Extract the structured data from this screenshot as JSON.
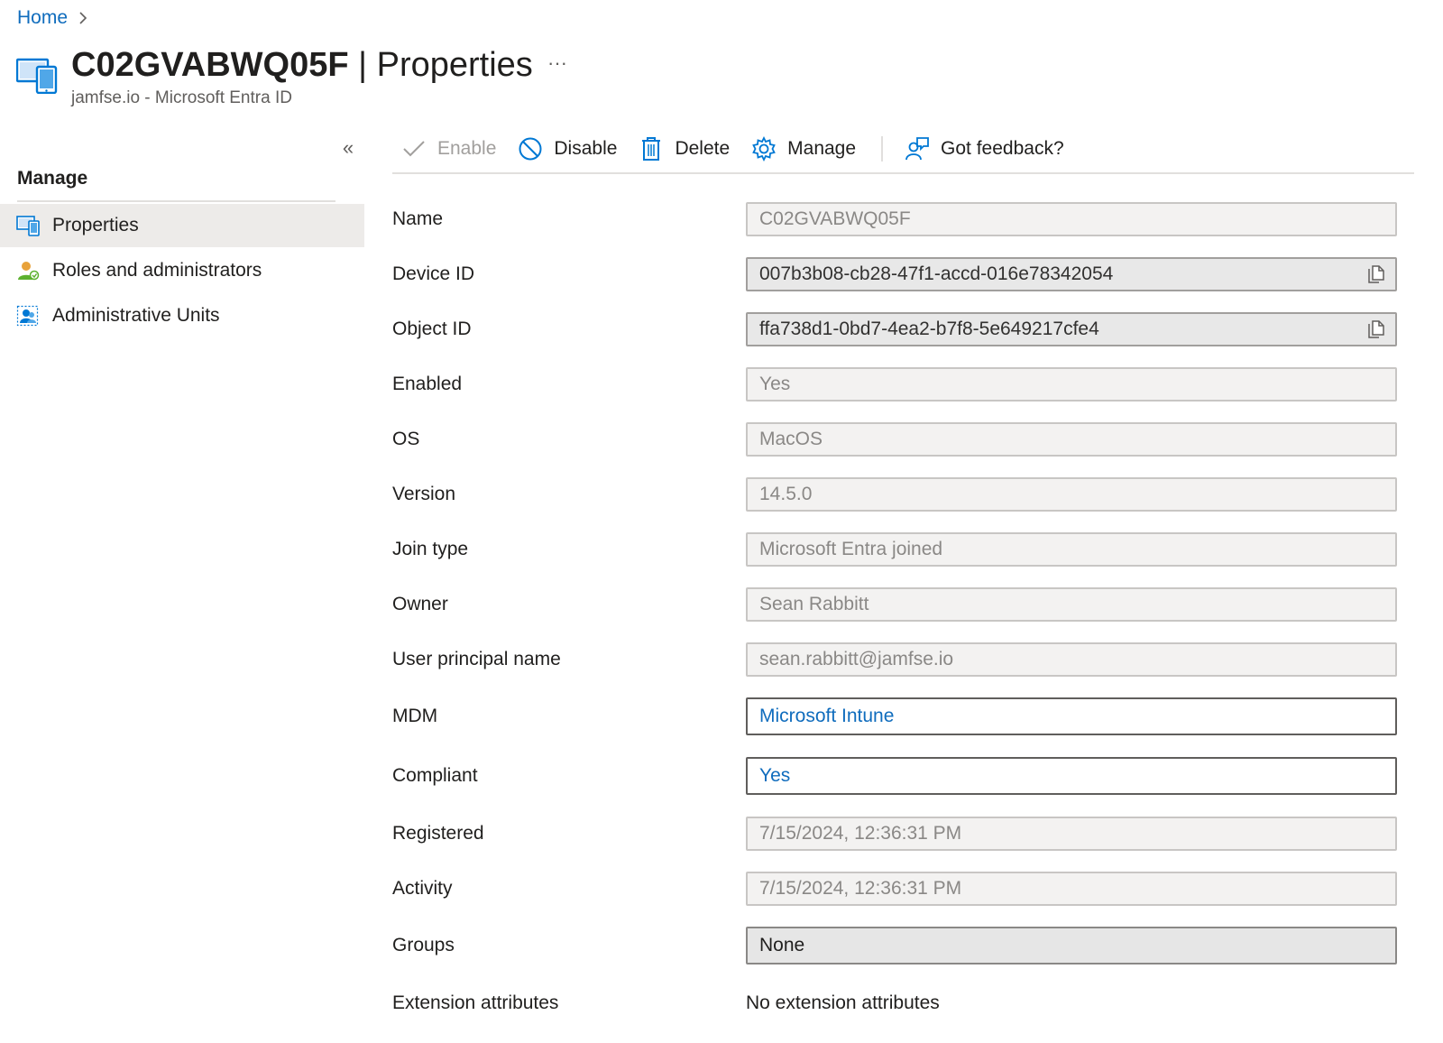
{
  "breadcrumb": {
    "home": "Home"
  },
  "header": {
    "device_name": "C02GVABWQ05F",
    "separator": " | ",
    "page_name": "Properties",
    "more": "···",
    "subtitle": "jamfse.io - Microsoft Entra ID"
  },
  "sidebar": {
    "heading": "Manage",
    "collapse": "«",
    "items": [
      {
        "label": "Properties",
        "icon": "device-properties-icon",
        "active": true
      },
      {
        "label": "Roles and administrators",
        "icon": "person-role-icon",
        "active": false
      },
      {
        "label": "Administrative Units",
        "icon": "admin-units-icon",
        "active": false
      }
    ]
  },
  "toolbar": {
    "enable": "Enable",
    "disable": "Disable",
    "delete": "Delete",
    "manage": "Manage",
    "feedback": "Got feedback?"
  },
  "properties": {
    "name": {
      "label": "Name",
      "value": "C02GVABWQ05F"
    },
    "device_id": {
      "label": "Device ID",
      "value": "007b3b08-cb28-47f1-accd-016e78342054"
    },
    "object_id": {
      "label": "Object ID",
      "value": "ffa738d1-0bd7-4ea2-b7f8-5e649217cfe4"
    },
    "enabled": {
      "label": "Enabled",
      "value": "Yes"
    },
    "os": {
      "label": "OS",
      "value": "MacOS"
    },
    "version": {
      "label": "Version",
      "value": "14.5.0"
    },
    "join_type": {
      "label": "Join type",
      "value": "Microsoft Entra joined"
    },
    "owner": {
      "label": "Owner",
      "value": "Sean Rabbitt"
    },
    "upn": {
      "label": "User principal name",
      "value": "sean.rabbitt@jamfse.io"
    },
    "mdm": {
      "label": "MDM",
      "value": "Microsoft Intune"
    },
    "compliant": {
      "label": "Compliant",
      "value": "Yes"
    },
    "registered": {
      "label": "Registered",
      "value": "7/15/2024, 12:36:31 PM"
    },
    "activity": {
      "label": "Activity",
      "value": "7/15/2024, 12:36:31 PM"
    },
    "groups": {
      "label": "Groups",
      "value": "None"
    },
    "extension_attributes": {
      "label": "Extension attributes",
      "value": "No extension attributes"
    }
  },
  "colors": {
    "link": "#0f6cbd",
    "accent": "#0078d4",
    "nav_active_bg": "#edebe9"
  }
}
